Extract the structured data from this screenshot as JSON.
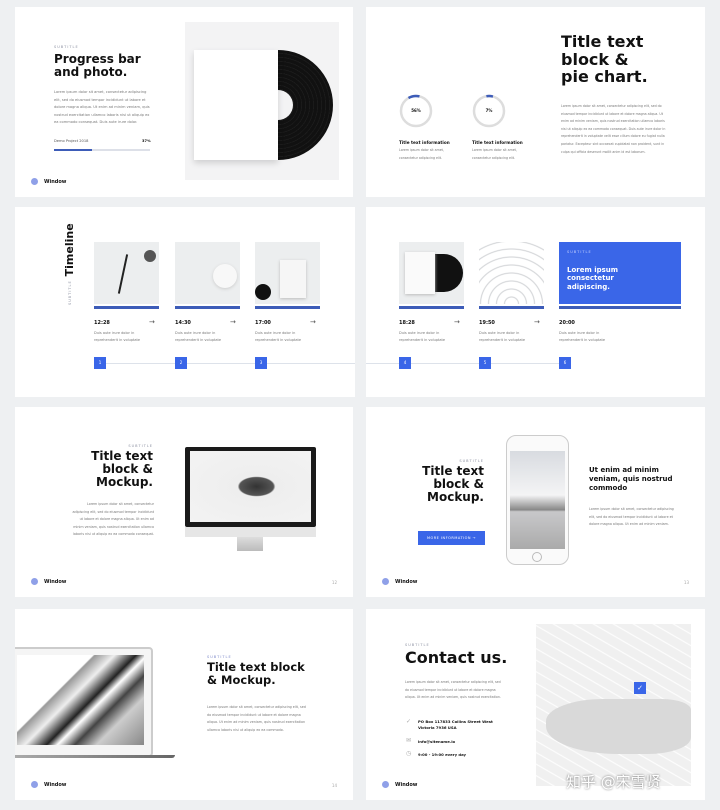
{
  "brand": "Window",
  "accent": "#3a66e8",
  "slide1": {
    "subtitle": "SUBTITLE",
    "title": "Progress bar and photo.",
    "body": "Lorem ipsum dolor sit amet, consectetur adipiscing elit, sed do eiusmod tempor incididunt ut labore et dolore magna aliqua. Ut enim ad minim veniam, quis nostrud exercitation ullamco laboris nisi ut aliquip ex ea commodo consequat. Duis aute irure dolor.",
    "progress_label": "Demo Project 2018",
    "progress_value": "37%",
    "progress_fraction": 0.4
  },
  "slide2": {
    "title": "Title text block & pie chart.",
    "body": "Lorem ipsum dolor sit amet, consectetur adipiscing elit, sed do eiusmod tempor incididunt ut labore et dolore magna aliqua. Ut enim ad minim veniam, quis nostrud exercitation ullamco laboris nisi ut aliquip ex ea commodo consequat. Duis aute irure dolor in reprehenderit in voluptate velit esse cillum dolore eu fugiat nulla pariatur. Excepteur sint occaecat cupidatat non proident, sunt in culpa qui officia deserunt mollit anim id est laborum.",
    "pies": [
      {
        "value": "56%",
        "fraction": 0.12,
        "label": "Title text information",
        "desc": "Lorem ipsum dolor sit amet, consectetur adipiscing elit."
      },
      {
        "value": "7%",
        "fraction": 0.07,
        "label": "Title text information",
        "desc": "Lorem ipsum dolor sit amet, consectetur adipiscing elit."
      }
    ]
  },
  "timeline": {
    "subtitle": "SUBTITLE",
    "title": "Timeline",
    "items": [
      {
        "time": "12:28",
        "step": "1",
        "desc": "Duis aute irure dolor in reprehenderit in voluptate"
      },
      {
        "time": "14:30",
        "step": "2",
        "desc": "Duis aute irure dolor in reprehenderit in voluptate"
      },
      {
        "time": "17:00",
        "step": "3",
        "desc": "Duis aute irure dolor in reprehenderit in voluptate"
      },
      {
        "time": "18:28",
        "step": "4",
        "desc": "Duis aute irure dolor in reprehenderit in voluptate"
      },
      {
        "time": "19:50",
        "step": "5",
        "desc": "Duis aute irure dolor in reprehenderit in voluptate"
      },
      {
        "time": "20:00",
        "step": "6",
        "desc": "Duis aute irure dolor in reprehenderit in voluptate"
      }
    ],
    "card_subtitle": "SUBTITLE",
    "card_text": "Lorem ipsum consectetur adipiscing."
  },
  "slide5": {
    "subtitle": "SUBTITLE",
    "title": "Title text block & Mockup.",
    "body": "Lorem ipsum dolor sit amet, consectetur adipiscing elit, sed do eiusmod tempor incididunt ut labore et dolore magna aliqua. Ut enim ad minim veniam, quis nostrud exercitation ullamco laboris nisi ut aliquip ex ea commodo consequat.",
    "page": "12"
  },
  "slide6": {
    "subtitle": "SUBTITLE",
    "title": "Title text block & Mockup.",
    "button": "MORE INFORMATION  →",
    "heading": "Ut enim ad minim veniam, quis nostrud commodo",
    "body": "Lorem ipsum dolor sit amet, consectetur adipiscing elit, sed do eiusmod tempor incididunt ut labore et dolore magna aliqua. Ut enim ad minim veniam.",
    "page": "13"
  },
  "slide7": {
    "subtitle": "SUBTITLE",
    "title": "Title text block & Mockup.",
    "body": "Lorem ipsum dolor sit amet, consectetur adipiscing elit, sed do eiusmod tempor incididunt ut labore et dolore magna aliqua. Ut enim ad minim veniam, quis nostrud exercitation ullamco laboris nisi ut aliquip ex ea commodo.",
    "page": "14"
  },
  "slide8": {
    "subtitle": "SUBTITLE",
    "title": "Contact us.",
    "body": "Lorem ipsum dolor sit amet, consectetur adipiscing elit, sed do eiusmod tempor incididunt ut labore et dolore magna aliqua. Ut enim ad minim veniam, quis nostrud exercitation.",
    "address": "PO Box 117833 Collins Street West Victoria 7936 USA",
    "email": "info@sitename.io",
    "hours": "9:00 - 19:00 every day"
  },
  "watermark": "知乎 @宋雪贤"
}
